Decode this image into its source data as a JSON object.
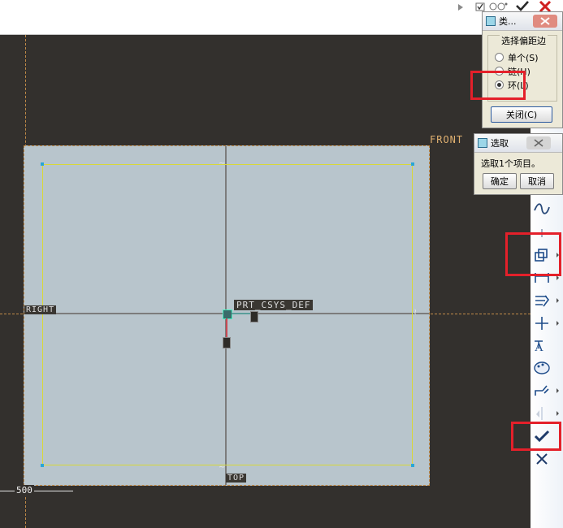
{
  "topbar": {
    "icons": [
      "checkbox-icon",
      "glasses-icon",
      "confirm-check-icon",
      "cancel-x-icon"
    ]
  },
  "canvas": {
    "datums": {
      "front": "FRONT",
      "right": "RIGHT",
      "top": "TOP",
      "csys": "PRT_CSYS_DEF"
    },
    "dimension_value": "500"
  },
  "type_dialog": {
    "title": "类...",
    "group_label": "选择偏距边",
    "options": [
      {
        "label": "单个(S)",
        "selected": false
      },
      {
        "label": "链(H)",
        "selected": false
      },
      {
        "label": "环(L)",
        "selected": true
      }
    ],
    "close_button": "关闭(C)"
  },
  "select_dialog": {
    "title": "选取",
    "message": "选取1个项目。",
    "ok_button": "确定",
    "cancel_button": "取消"
  },
  "toolbar": {
    "tools": [
      "spline-icon",
      "point-icon",
      "offset-edge-icon",
      "dimension-icon",
      "constraint-icon",
      "centerline-icon",
      "text-icon",
      "palette-icon",
      "trim-icon",
      "mirror-icon",
      "accept-check-icon",
      "cancel-x-icon"
    ]
  },
  "highlights": {
    "color": "#e4202a"
  }
}
